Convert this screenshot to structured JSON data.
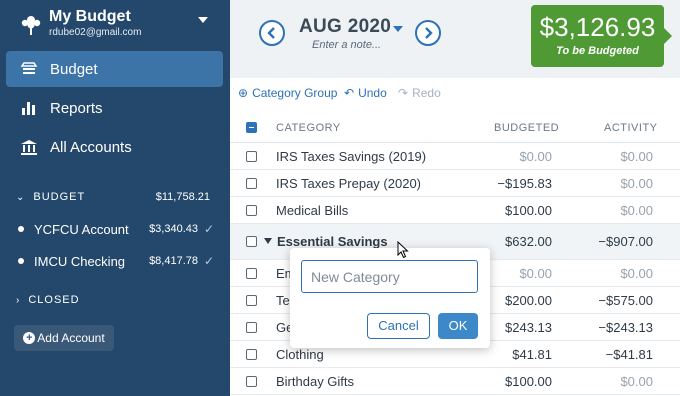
{
  "sidebar": {
    "budget_name": "My Budget",
    "email": "rdube02@gmail.com",
    "nav": [
      {
        "label": "Budget",
        "icon": "budget-icon"
      },
      {
        "label": "Reports",
        "icon": "reports-icon"
      },
      {
        "label": "All Accounts",
        "icon": "bank-icon"
      }
    ],
    "budget_section": {
      "label": "BUDGET",
      "amount": "$11,758.21"
    },
    "accounts": [
      {
        "name": "YCFCU Account",
        "balance": "$3,340.43"
      },
      {
        "name": "IMCU Checking",
        "balance": "$8,417.78"
      }
    ],
    "closed_label": "CLOSED",
    "add_account_label": "Add Account"
  },
  "header": {
    "month": "AUG 2020",
    "note_placeholder": "Enter a note...",
    "to_be_budgeted_amount": "$3,126.93",
    "to_be_budgeted_label": "To be Budgeted",
    "accent_color": "#2d72b8",
    "positive_color": "#4f9a35"
  },
  "toolbar": {
    "category_group_label": "Category Group",
    "undo_label": "Undo",
    "redo_label": "Redo"
  },
  "table": {
    "columns": [
      "CATEGORY",
      "BUDGETED",
      "ACTIVITY"
    ],
    "rows": [
      {
        "name": "IRS Taxes Savings (2019)",
        "budgeted": "$0.00",
        "activity": "$0.00"
      },
      {
        "name": "IRS Taxes Prepay (2020)",
        "budgeted": "−$195.83",
        "activity": "$0.00"
      },
      {
        "name": "Medical Bills",
        "budgeted": "$100.00",
        "activity": "$0.00"
      },
      {
        "name": "Essential Savings",
        "budgeted": "$632.00",
        "activity": "−$907.00",
        "group": true
      },
      {
        "name": "Em",
        "budgeted": "$0.00",
        "activity": "$0.00"
      },
      {
        "name": "Te",
        "budgeted": "$200.00",
        "activity": "−$575.00"
      },
      {
        "name": "Ge",
        "budgeted": "$243.13",
        "activity": "−$243.13"
      },
      {
        "name": "Clothing",
        "budgeted": "$41.81",
        "activity": "−$41.81"
      },
      {
        "name": "Birthday Gifts",
        "budgeted": "$100.00",
        "activity": "$0.00"
      }
    ]
  },
  "popover": {
    "input_placeholder": "New Category",
    "cancel_label": "Cancel",
    "ok_label": "OK"
  }
}
